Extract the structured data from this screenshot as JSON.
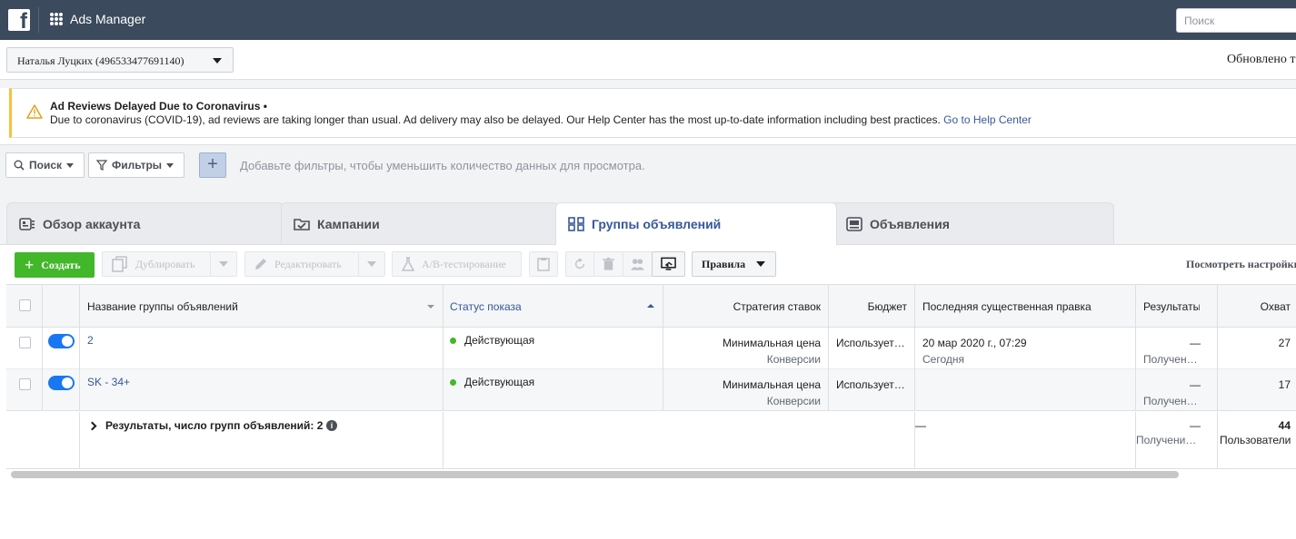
{
  "topbar": {
    "app_title": "Ads Manager",
    "search_placeholder": "Поиск"
  },
  "account": {
    "selected": "Наталья Луцких (496533477691140)",
    "updated_text": "Обновлено т"
  },
  "notice": {
    "title": "Ad Reviews Delayed Due to Coronavirus •",
    "body": "Due to coronavirus (COVID-19), ad reviews are taking longer than usual. Ad delivery may also be delayed. Our Help Center has the most up-to-date information including best practices.",
    "link": "Go to Help Center"
  },
  "filters": {
    "search_label": "Поиск",
    "filters_label": "Фильтры",
    "add_label": "+",
    "hint": "Добавьте фильтры, чтобы уменьшить количество данных для просмотра."
  },
  "tabs": [
    {
      "label": "Обзор аккаунта",
      "icon": "account-overview-icon"
    },
    {
      "label": "Кампании",
      "icon": "folder-check-icon"
    },
    {
      "label": "Группы объявлений",
      "icon": "grid-icon"
    },
    {
      "label": "Объявления",
      "icon": "ad-icon"
    }
  ],
  "toolbar": {
    "create": "Создать",
    "duplicate": "Дублировать",
    "edit": "Редактировать",
    "ab_test": "A/B-тестирование",
    "rules": "Правила",
    "view_settings": "Посмотреть настройки"
  },
  "table": {
    "headers": {
      "name": "Название группы объявлений",
      "status": "Статус показа",
      "bid": "Стратегия ставок",
      "budget": "Бюджет",
      "last_edit": "Последняя существенная правка",
      "results": "Результаты",
      "reach": "Охват"
    },
    "rows": [
      {
        "name": "2",
        "status": "Действующая",
        "bid_line1": "Минимальная цена",
        "bid_line2": "Конверсии",
        "budget": "Использует…",
        "last_edit_line1": "20 мар 2020 г., 07:29",
        "last_edit_line2": "Сегодня",
        "results_line1": "—",
        "results_line2": "Получен…",
        "reach": "27"
      },
      {
        "name": "SK - 34+",
        "status": "Действующая",
        "bid_line1": "Минимальная цена",
        "bid_line2": "Конверсии",
        "budget": "Использует…",
        "last_edit_line1": "",
        "last_edit_line2": "",
        "results_line1": "—",
        "results_line2": "Получен…",
        "reach": "17"
      }
    ],
    "summary": {
      "label": "Результаты, число групп объявлений: 2",
      "last_edit": "—",
      "results_line1": "—",
      "results_line2": "Получени…",
      "reach_line1": "44",
      "reach_line2": "Пользователи"
    }
  },
  "colors": {
    "topbar": "#3b4a5c",
    "accent": "#365899",
    "create": "#42b72a",
    "toggle": "#1877f2",
    "warning": "#f5c33b"
  }
}
